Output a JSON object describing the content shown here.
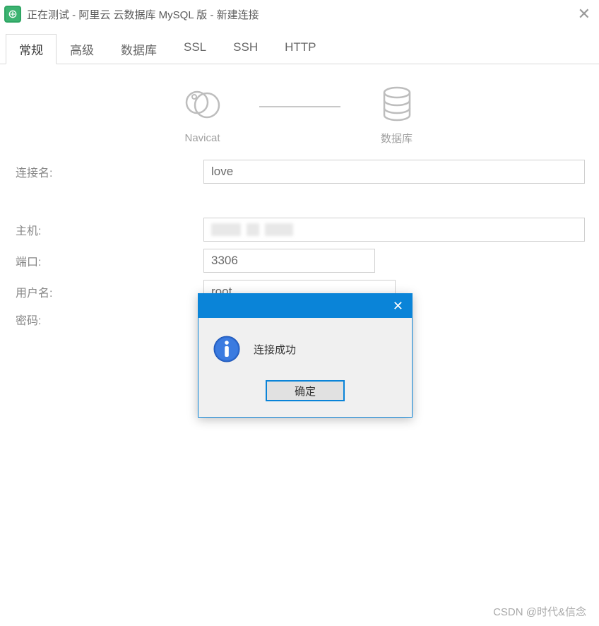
{
  "window": {
    "title": "正在测试 - 阿里云 云数据库 MySQL 版 - 新建连接"
  },
  "tabs": {
    "general": "常规",
    "advanced": "高级",
    "database": "数据库",
    "ssl": "SSL",
    "ssh": "SSH",
    "http": "HTTP"
  },
  "diagram": {
    "navicat": "Navicat",
    "database": "数据库"
  },
  "form": {
    "connection_name_label": "连接名:",
    "connection_name_value": "love",
    "host_label": "主机:",
    "host_value": "",
    "port_label": "端口:",
    "port_value": "3306",
    "username_label": "用户名:",
    "username_value": "root",
    "password_label": "密码:"
  },
  "modal": {
    "message": "连接成功",
    "ok": "确定"
  },
  "watermark": "CSDN @时代&信念"
}
